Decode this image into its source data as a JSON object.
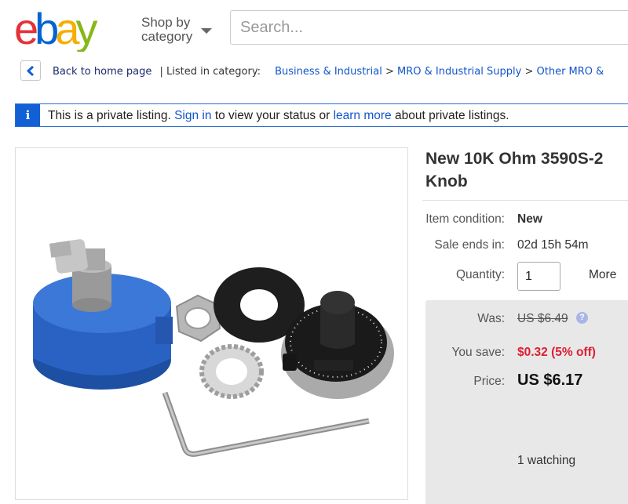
{
  "header": {
    "logo_letters": [
      "e",
      "b",
      "a",
      "y"
    ],
    "logo_colors": [
      "#e53238",
      "#0064d2",
      "#f5af02",
      "#86b817"
    ],
    "shop_by_line1": "Shop by",
    "shop_by_line2": "category",
    "search_placeholder": "Search..."
  },
  "breadcrumb": {
    "back_label": "Back to home page",
    "listed_in": "| Listed in category:",
    "items": [
      "Business & Industrial",
      "MRO & Industrial Supply",
      "Other MRO &"
    ],
    "separator": ">"
  },
  "banner": {
    "icon": "i",
    "text_1": "This is a private listing.",
    "sign_in": "Sign in",
    "text_2": "to view your status or",
    "learn_more": "learn more",
    "text_3": "about private listings."
  },
  "item": {
    "title_line1": "New 10K Ohm 3590S-2",
    "title_line2": "Knob",
    "condition_label": "Item condition:",
    "condition_value": "New",
    "sale_ends_label": "Sale ends in:",
    "sale_ends_value": "02d 15h 54m",
    "quantity_label": "Quantity:",
    "quantity_value": "1",
    "more_label": "More",
    "was_label": "Was:",
    "was_value": "US $6.49",
    "save_label": "You save:",
    "save_value": "$0.32 (5% off)",
    "price_label": "Price:",
    "price_value": "US $6.17",
    "watching": "1 watching",
    "help_icon": "?"
  },
  "colors": {
    "link": "#1155cc",
    "discount": "#dd1e31",
    "banner_blue": "#1160d6"
  }
}
